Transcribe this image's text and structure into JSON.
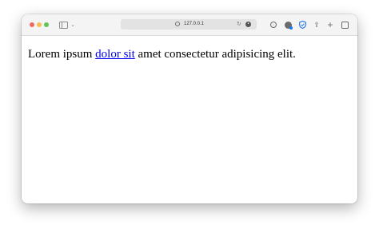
{
  "browser": {
    "url": "127.0.0.1",
    "icons": {
      "traffic_lights": [
        "close-icon",
        "minimize-icon",
        "zoom-icon"
      ],
      "left": [
        "sidebar-icon",
        "chevron-down-icon"
      ],
      "url_bar": [
        "globe-icon",
        "reload-icon",
        "extension-icon"
      ],
      "right": [
        "download-icon",
        "extension-badge-icon",
        "shield-icon",
        "share-icon",
        "plus-icon",
        "tabs-overview-icon"
      ]
    },
    "colors": {
      "close": "#ed6a5e",
      "minimize": "#f5bf4f",
      "zoom": "#61c554",
      "link": "#0000ee"
    }
  },
  "page": {
    "text_before": "Lorem ipsum ",
    "link_text": "dolor sit",
    "text_after": " amet consectetur adipisicing elit."
  }
}
